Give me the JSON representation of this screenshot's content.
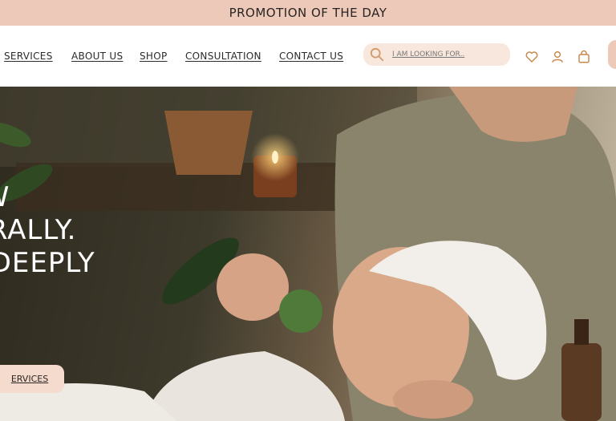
{
  "promo": {
    "text": "PROMOTION OF THE DAY"
  },
  "nav": {
    "links": [
      "SERVICES",
      "ABOUT US",
      "SHOP",
      "CONSULTATION",
      "CONTACT US"
    ],
    "search_placeholder": "I AM LOOKING FOR..",
    "icons": [
      "search-icon",
      "heart-icon",
      "user-icon",
      "bag-icon"
    ]
  },
  "hero": {
    "headline": [
      "OW",
      "URALLY.",
      "L DEEPLY"
    ],
    "cta_label": "ERVICES"
  },
  "colors": {
    "promo_bg": "#ecc9b8",
    "accent": "#f4dbcd",
    "icon": "#c98a4e"
  }
}
